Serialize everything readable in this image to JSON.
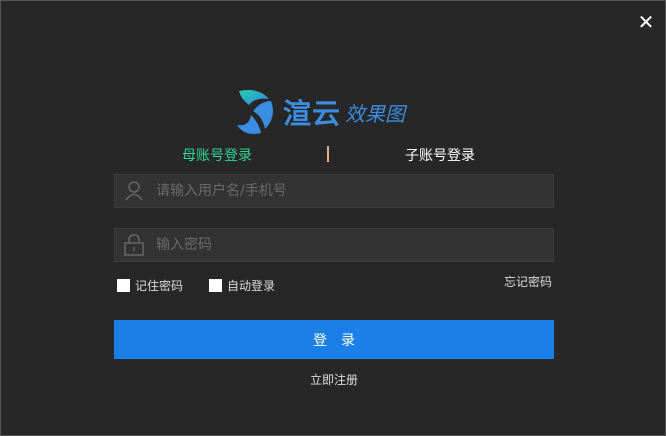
{
  "window": {
    "close_icon": "close-icon"
  },
  "logo": {
    "name": "渲云",
    "subtitle": "效果图"
  },
  "tabs": [
    {
      "label": "母账号登录",
      "active": true
    },
    {
      "label": "子账号登录",
      "active": false
    }
  ],
  "username": {
    "placeholder": "请输入用户名/手机号",
    "value": ""
  },
  "password": {
    "placeholder": "输入密码",
    "value": ""
  },
  "remember_label": "记住密码",
  "auto_login_label": "自动登录",
  "forgot_label": "忘记密码",
  "login_label": "登录",
  "register_label": "立即注册",
  "colors": {
    "accent": "#1a7fe8",
    "active_tab": "#2ed69a",
    "background": "#272727"
  }
}
